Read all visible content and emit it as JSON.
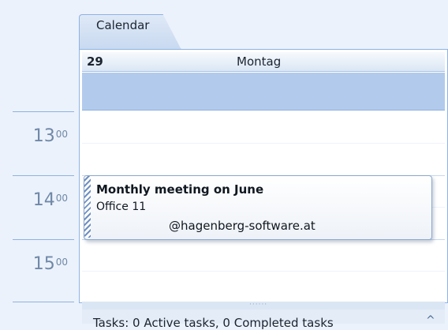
{
  "tab": {
    "label": "Calendar"
  },
  "day_header": {
    "day_number": "29",
    "day_name": "Montag"
  },
  "time_gutter": {
    "hours": [
      {
        "hour": "13",
        "minutes": "00"
      },
      {
        "hour": "14",
        "minutes": "00"
      },
      {
        "hour": "15",
        "minutes": "00"
      }
    ]
  },
  "appointment": {
    "title": "Monthly meeting on June",
    "location": "Office 11",
    "organizer": "@hagenberg-software.at"
  },
  "tasks_bar": {
    "text": "Tasks: 0 Active tasks, 0 Completed tasks",
    "grip": "······",
    "chevron": "^"
  },
  "colors": {
    "background": "#ecf2fb",
    "border": "#8db2e3",
    "allday_band": "#b2cbec",
    "hour_label": "#6f88a8"
  },
  "icons": {
    "tasks_chevron": "chevron-up-icon",
    "splitter_grip": "grip-icon"
  }
}
